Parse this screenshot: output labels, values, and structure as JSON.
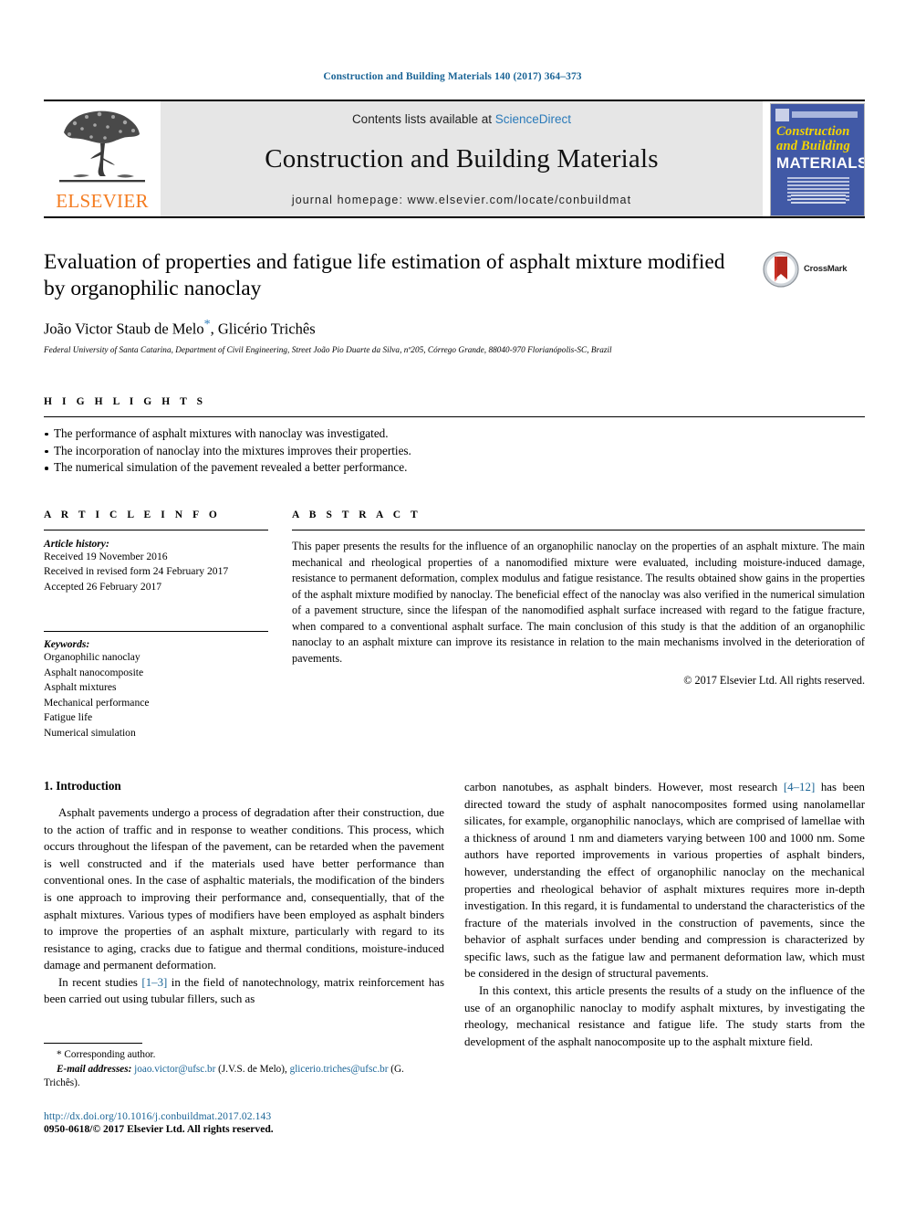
{
  "running_head": "Construction and Building Materials 140 (2017) 364–373",
  "masthead": {
    "publisher_name": "ELSEVIER",
    "contents_prefix": "Contents lists available at ",
    "contents_link": "ScienceDirect",
    "journal_name": "Construction and Building Materials",
    "homepage": "journal homepage: www.elsevier.com/locate/conbuildmat",
    "cover": {
      "line1": "Construction",
      "line2": "and Building",
      "line3": "MATERIALS"
    }
  },
  "article": {
    "title": "Evaluation of properties and fatigue life estimation of asphalt mixture modified by organophilic nanoclay",
    "authors": "João Victor Staub de Melo",
    "authors_rest": ", Glicério Trichês",
    "corresponding_mark": "*",
    "affiliation": "Federal University of Santa Catarina, Department of Civil Engineering, Street João Pio Duarte da Silva, nº205, Córrego Grande, 88040-970 Florianópolis-SC, Brazil",
    "crossmark_label": "CrossMark"
  },
  "highlights": {
    "heading": "H I G H L I G H T S",
    "items": [
      "The performance of asphalt mixtures with nanoclay was investigated.",
      "The incorporation of nanoclay into the mixtures improves their properties.",
      "The numerical simulation of the pavement revealed a better performance."
    ]
  },
  "article_info": {
    "heading": "A R T I C L E    I N F O",
    "history_label": "Article history:",
    "history": [
      "Received 19 November 2016",
      "Received in revised form 24 February 2017",
      "Accepted 26 February 2017"
    ],
    "keywords_label": "Keywords:",
    "keywords": [
      "Organophilic nanoclay",
      "Asphalt nanocomposite",
      "Asphalt mixtures",
      "Mechanical performance",
      "Fatigue life",
      "Numerical simulation"
    ]
  },
  "abstract": {
    "heading": "A B S T R A C T",
    "text": "This paper presents the results for the influence of an organophilic nanoclay on the properties of an asphalt mixture. The main mechanical and rheological properties of a nanomodified mixture were evaluated, including moisture-induced damage, resistance to permanent deformation, complex modulus and fatigue resistance. The results obtained show gains in the properties of the asphalt mixture modified by nanoclay. The beneficial effect of the nanoclay was also verified in the numerical simulation of a pavement structure, since the lifespan of the nanomodified asphalt surface increased with regard to the fatigue fracture, when compared to a conventional asphalt surface. The main conclusion of this study is that the addition of an organophilic nanoclay to an asphalt mixture can improve its resistance in relation to the main mechanisms involved in the deterioration of pavements.",
    "copyright": "© 2017 Elsevier Ltd. All rights reserved."
  },
  "introduction": {
    "heading": "1. Introduction",
    "left_p1": "Asphalt pavements undergo a process of degradation after their construction, due to the action of traffic and in response to weather conditions. This process, which occurs throughout the lifespan of the pavement, can be retarded when the pavement is well constructed and if the materials used have better performance than conventional ones. In the case of asphaltic materials, the modification of the binders is one approach to improving their performance and, consequentially, that of the asphalt mixtures. Various types of modifiers have been employed as asphalt binders to improve the properties of an asphalt mixture, particularly with regard to its resistance to aging, cracks due to fatigue and thermal conditions, moisture-induced damage and permanent deformation.",
    "left_p2_a": "In recent studies ",
    "left_p2_ref": "[1–3]",
    "left_p2_b": " in the field of nanotechnology, matrix reinforcement has been carried out using tubular fillers, such as",
    "right_p1_a": "carbon nanotubes, as asphalt binders. However, most research ",
    "right_p1_ref": "[4–12]",
    "right_p1_b": " has been directed toward the study of asphalt nanocomposites formed using nanolamellar silicates, for example, organophilic nanoclays, which are comprised of lamellae with a thickness of around 1 nm and diameters varying between 100 and 1000 nm. Some authors have reported improvements in various properties of asphalt binders, however, understanding the effect of organophilic nanoclay on the mechanical properties and rheological behavior of asphalt mixtures requires more in-depth investigation. In this regard, it is fundamental to understand the characteristics of the fracture of the materials involved in the construction of pavements, since the behavior of asphalt surfaces under bending and compression is characterized by specific laws, such as the fatigue law and permanent deformation law, which must be considered in the design of structural pavements.",
    "right_p2": "In this context, this article presents the results of a study on the influence of the use of an organophilic nanoclay to modify asphalt mixtures, by investigating the rheology, mechanical resistance and fatigue life. The study starts from the development of the asphalt nanocomposite up to the asphalt mixture field."
  },
  "footnote": {
    "corresponding": "* Corresponding author.",
    "email_label": "E-mail addresses:",
    "email1": "joao.victor@ufsc.br",
    "email1_attr": " (J.V.S. de Melo), ",
    "email2": "glicerio.triches@ufsc.br",
    "email2_attr": " (G. Trichês)."
  },
  "footer": {
    "doi": "http://dx.doi.org/10.1016/j.conbuildmat.2017.02.143",
    "issn": "0950-0618/© 2017 Elsevier Ltd. All rights reserved."
  },
  "colors": {
    "link": "#1a6496",
    "sciencedirect": "#2a7ab9",
    "elsevier_orange": "#F47C20",
    "cover_blue": "#4159a6"
  }
}
